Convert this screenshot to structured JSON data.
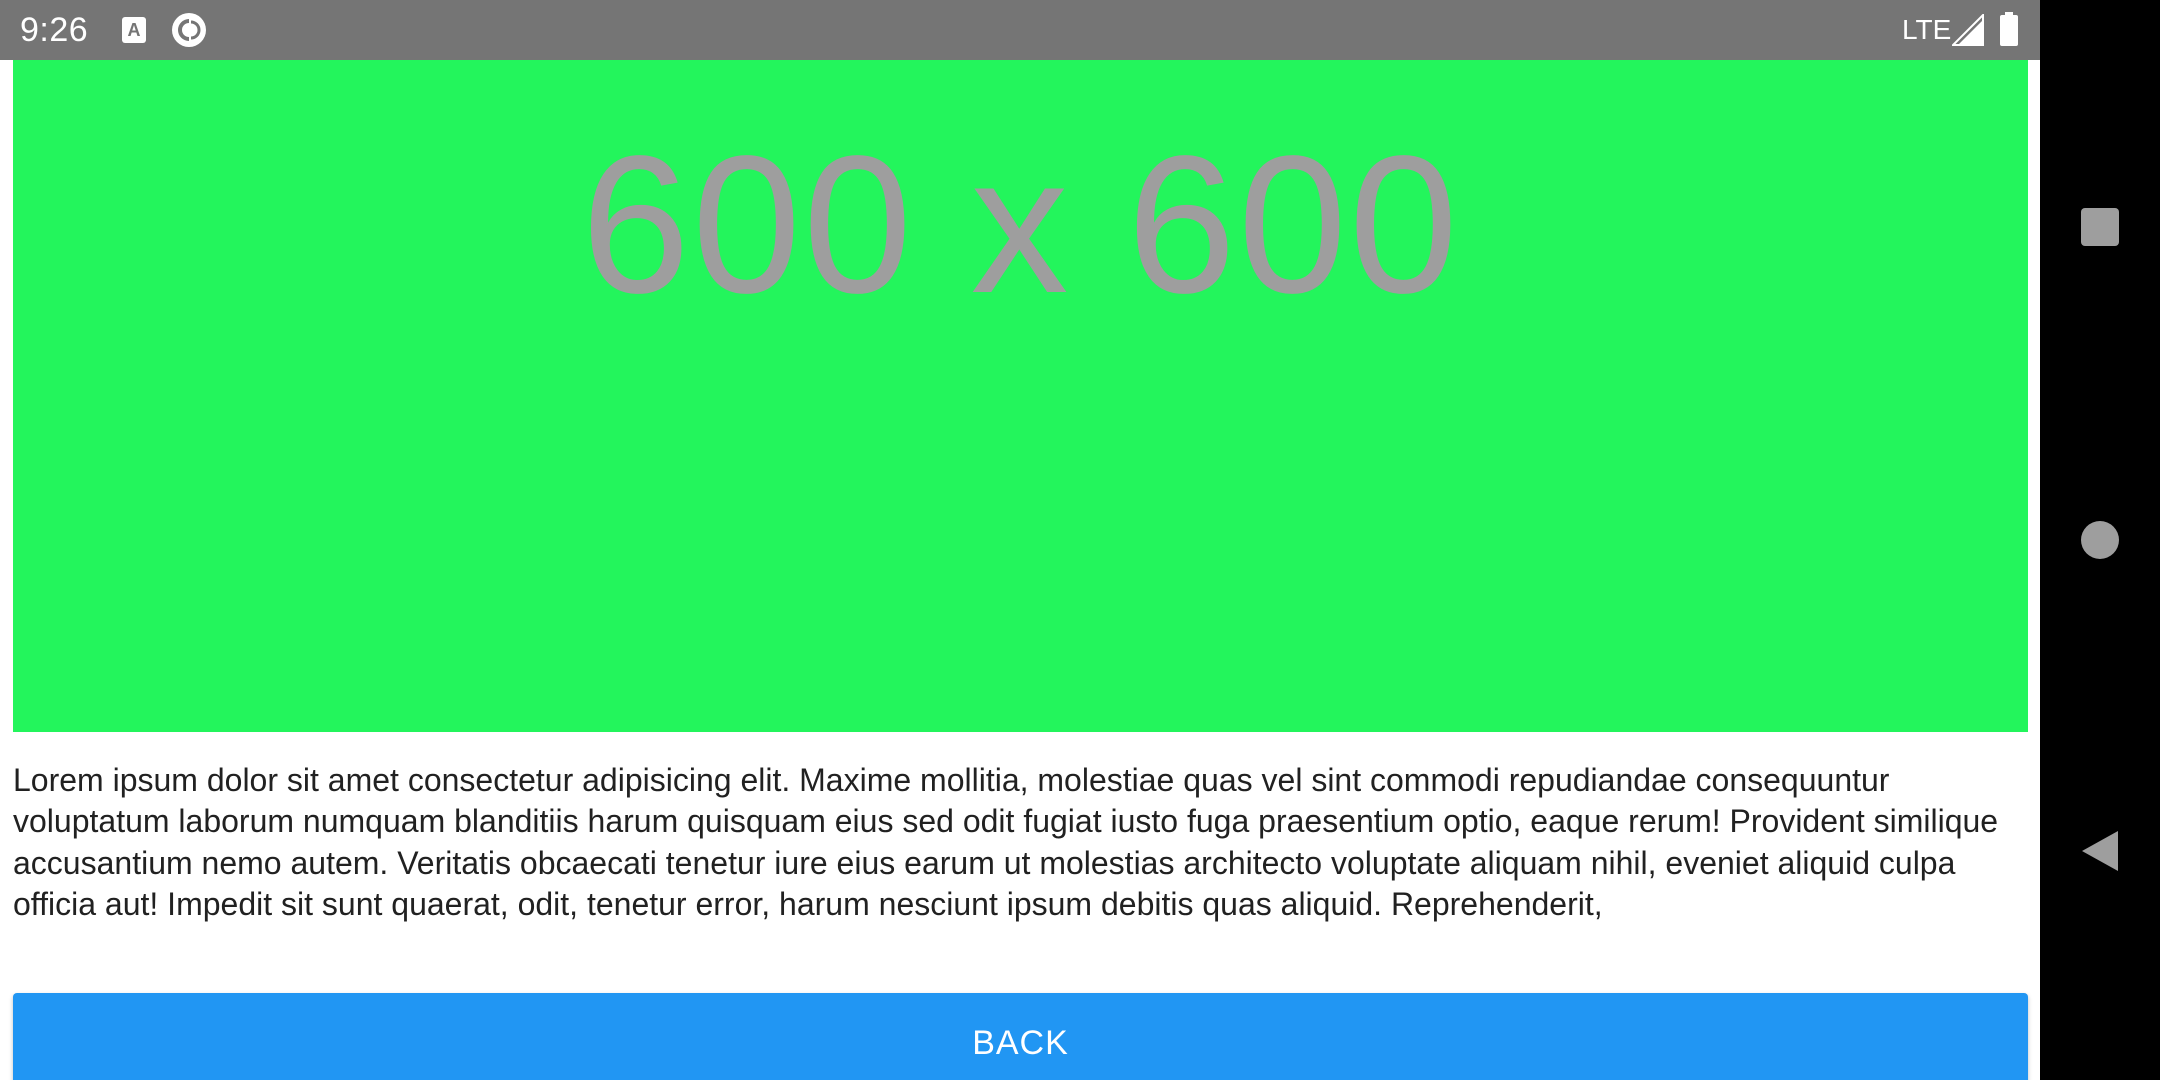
{
  "status_bar": {
    "time": "9:26",
    "network": "LTE",
    "background_color": "#757575",
    "icons": [
      "font-a-icon",
      "pocket-casts-icon",
      "signal-icon",
      "battery-icon"
    ],
    "icon_a_letter": "A"
  },
  "nav_bar": {
    "items": [
      "recent-apps",
      "home",
      "back"
    ],
    "background_color": "#000000"
  },
  "image": {
    "placeholder_text": "600 x 600",
    "background_color": "#23f55c",
    "text_color": "#9e9e9e"
  },
  "description": "Lorem ipsum dolor sit amet consectetur adipisicing elit. Maxime mollitia, molestiae quas vel sint commodi repudiandae consequuntur voluptatum laborum numquam blanditiis harum quisquam eius sed odit fugiat iusto fuga praesentium optio, eaque rerum! Provident similique accusantium nemo autem. Veritatis obcaecati tenetur iure eius earum ut molestias architecto voluptate aliquam nihil, eveniet aliquid culpa officia aut! Impedit sit sunt quaerat, odit, tenetur error, harum nesciunt ipsum debitis quas aliquid. Reprehenderit,",
  "back_button": {
    "label": "BACK",
    "background_color": "#2196f3"
  }
}
